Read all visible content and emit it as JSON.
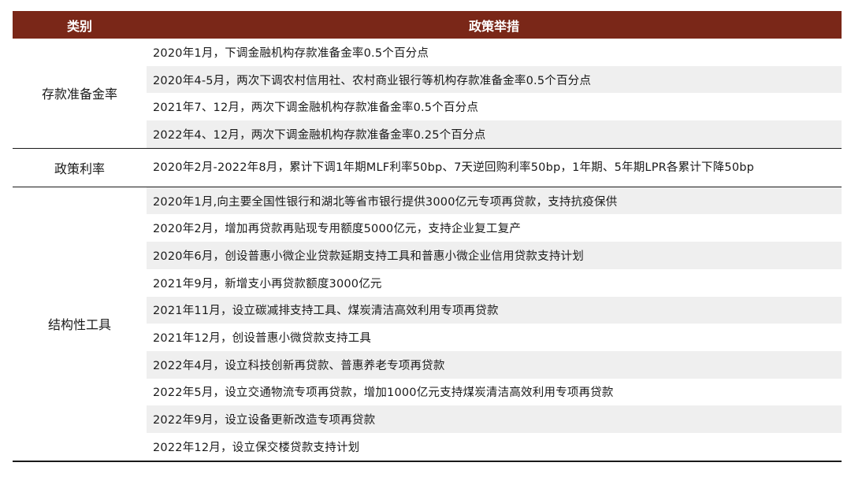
{
  "header": {
    "category": "类别",
    "measures": "政策举措"
  },
  "groups": [
    {
      "category": "存款准备金率",
      "items": [
        "2020年1月，下调金融机构存款准备金率0.5个百分点",
        "2020年4-5月，两次下调农村信用社、农村商业银行等机构存款准备金率0.5个百分点",
        "2021年7、12月，两次下调金融机构存款准备金率0.5个百分点",
        "2022年4、12月，两次下调金融机构存款准备金率0.25个百分点"
      ]
    },
    {
      "category": "政策利率",
      "items": [
        "2020年2月-2022年8月，累计下调1年期MLF利率50bp、7天逆回购利率50bp，1年期、5年期LPR各累计下降50bp"
      ]
    },
    {
      "category": "结构性工具",
      "items": [
        "2020年1月,向主要全国性银行和湖北等省市银行提供3000亿元专项再贷款，支持抗疫保供",
        "2020年2月，增加再贷款再贴现专用额度5000亿元，支持企业复工复产",
        "2020年6月，创设普惠小微企业贷款延期支持工具和普惠小微企业信用贷款支持计划",
        "2021年9月，新增支小再贷款额度3000亿元",
        "2021年11月，设立碳减排支持工具、煤炭清洁高效利用专项再贷款",
        "2021年12月，创设普惠小微贷款支持工具",
        "2022年4月，设立科技创新再贷款、普惠养老专项再贷款",
        "2022年5月，设立交通物流专项再贷款，增加1000亿元支持煤炭清洁高效利用专项再贷款",
        "2022年9月，设立设备更新改造专项再贷款",
        "2022年12月，设立保交楼贷款支持计划"
      ]
    }
  ]
}
